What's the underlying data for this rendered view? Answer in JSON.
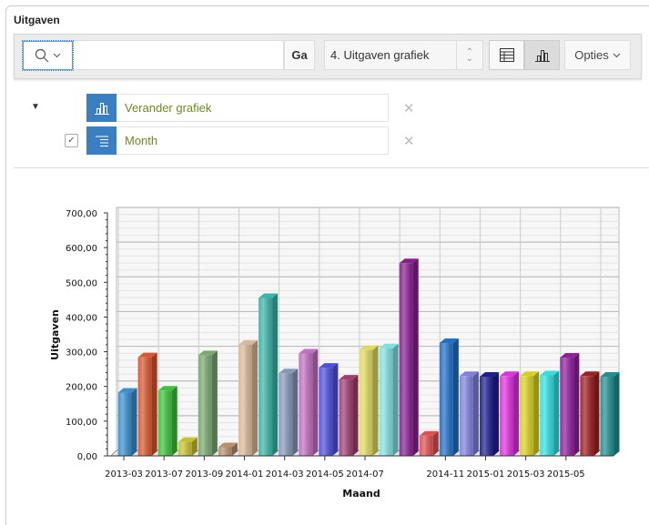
{
  "region": {
    "title": "Uitgaven"
  },
  "toolbar": {
    "search_placeholder": "",
    "go_label": "Ga",
    "report_select": "4. Uitgaven grafiek",
    "options_label": "Opties",
    "active_view": "chart"
  },
  "filters": [
    {
      "label": "Verander grafiek",
      "icon": "bar-chart-icon"
    },
    {
      "label": "Month",
      "icon": "group-by-icon",
      "checked": true
    }
  ],
  "chart_data": {
    "type": "bar",
    "style": "3d",
    "xlabel": "Maand",
    "ylabel": "Uitgaven",
    "ylim": [
      0,
      700
    ],
    "yticks": [
      "0,00",
      "100,00",
      "200,00",
      "300,00",
      "400,00",
      "500,00",
      "600,00",
      "700,00"
    ],
    "grid": true,
    "categories": [
      "2013-03",
      "",
      "2013-07",
      "",
      "2013-09",
      "",
      "2014-01",
      "",
      "2014-03",
      "",
      "2014-05",
      "",
      "2014-07",
      "",
      "",
      "",
      "2014-11",
      "",
      "2015-01",
      "",
      "2015-03",
      "",
      "2015-05",
      "",
      ""
    ],
    "values": [
      182,
      284,
      188,
      40,
      290,
      25,
      320,
      455,
      238,
      295,
      254,
      220,
      305,
      310,
      555,
      58,
      325,
      230,
      228,
      230,
      230,
      232,
      283,
      230,
      228
    ],
    "colors": [
      "#3a8fd0",
      "#d9572e",
      "#3cc23c",
      "#c8c030",
      "#7aa870",
      "#b89070",
      "#d8b898",
      "#3ab5a8",
      "#8898b8",
      "#c070c0",
      "#5050e0",
      "#a04070",
      "#e0d860",
      "#80e0e0",
      "#882090",
      "#e05050",
      "#2070c8",
      "#8080e0",
      "#202090",
      "#e030e0",
      "#d8d020",
      "#30e0e0",
      "#9020a0",
      "#a02020",
      "#209090"
    ]
  }
}
